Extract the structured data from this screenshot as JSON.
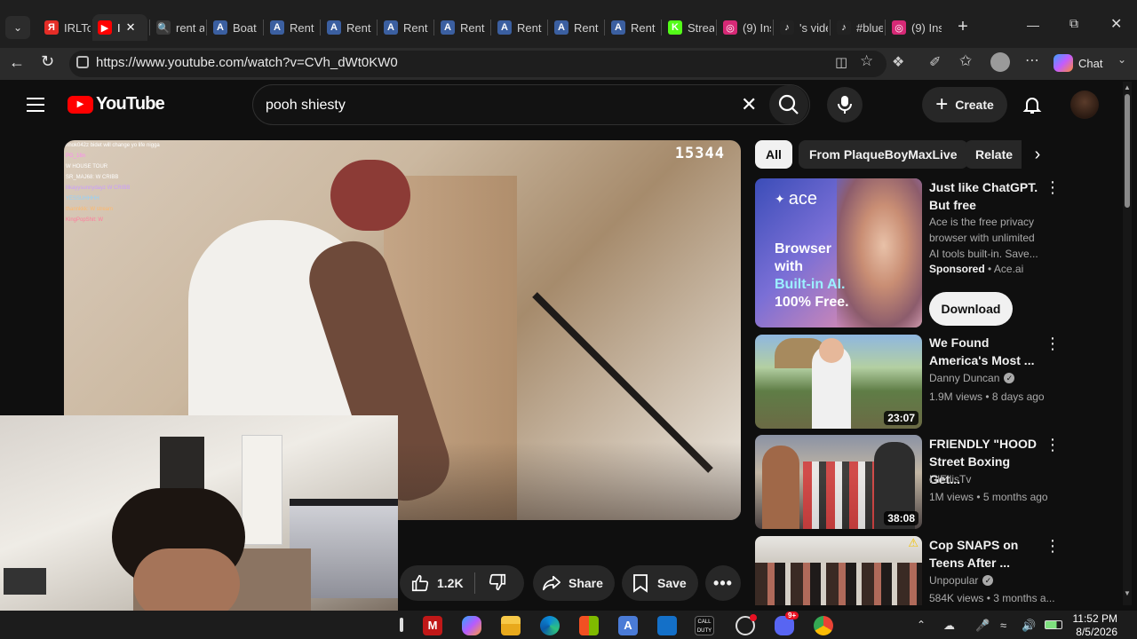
{
  "browser": {
    "tabs": [
      {
        "label": "IRLToo",
        "icon": "Я",
        "color": "#e52d27"
      },
      {
        "label": "I",
        "icon": "▶",
        "color": "#ff0000",
        "active": true
      },
      {
        "label": "rent a",
        "icon": "🔍",
        "color": "#3a3a3a"
      },
      {
        "label": "Boat",
        "icon": "A",
        "color": "#3b5fa0"
      },
      {
        "label": "Rent",
        "icon": "A",
        "color": "#3b5fa0"
      },
      {
        "label": "Rent",
        "icon": "A",
        "color": "#3b5fa0"
      },
      {
        "label": "Rent",
        "icon": "A",
        "color": "#3b5fa0"
      },
      {
        "label": "Rent",
        "icon": "A",
        "color": "#3b5fa0"
      },
      {
        "label": "Rent",
        "icon": "A",
        "color": "#3b5fa0"
      },
      {
        "label": "Rent",
        "icon": "A",
        "color": "#3b5fa0"
      },
      {
        "label": "Rent",
        "icon": "A",
        "color": "#3b5fa0"
      },
      {
        "label": "Strear",
        "icon": "K",
        "color": "#53fc18"
      },
      {
        "label": "(9) Ins",
        "icon": "◎",
        "color": "#d62976"
      },
      {
        "label": "'s vide",
        "icon": "♪",
        "color": "#222"
      },
      {
        "label": "#blue",
        "icon": "♪",
        "color": "#222"
      },
      {
        "label": "(9) Ins",
        "icon": "◎",
        "color": "#d62976"
      }
    ],
    "url": "https://www.youtube.com/watch?v=CVh_dWt0KW0",
    "chat_label": "Chat"
  },
  "youtube": {
    "logo_text": "YouTube",
    "search_value": "pooh shiesty",
    "create_label": "Create",
    "video_counter": "15344",
    "chat_messages": [
      "nnok042z bidet will change yo life nigga",
      "PG_16n",
      "W HOUSE TOUR",
      "SR_MAJ68: W CRIBB",
      "llikayysunnydayz W CRIBB",
      "YESSUHHHH",
      "thannkkk: W stream",
      "KingPopShit: W"
    ],
    "chips": [
      {
        "label": "All",
        "selected": true
      },
      {
        "label": "From PlaqueBoyMaxLive",
        "selected": false
      },
      {
        "label": "Relate",
        "selected": false
      }
    ],
    "ad": {
      "thumb_brand": "ace",
      "thumb_text": "Browser with Built-in AI. 100% Free.",
      "thumb_line1": "Browser",
      "thumb_line2": "with",
      "thumb_line3": "Built-in AI.",
      "thumb_line4": "100% Free.",
      "title": "Just like ChatGPT. But free",
      "description": "Ace is the free privacy browser with unlimited AI tools built-in. Save...",
      "sponsored": "Sponsored",
      "advertiser": "Ace.ai",
      "cta": "Download"
    },
    "recommendations": [
      {
        "title": "We Found America's Most ...",
        "channel": "Danny Duncan",
        "verified": true,
        "meta": "1.9M views • 8 days ago",
        "duration": "23:07"
      },
      {
        "title": "FRIENDLY \"HOOD Street Boxing Get...",
        "channel": "LilEllisTv",
        "verified": false,
        "meta": "1M views • 5 months ago",
        "duration": "38:08"
      },
      {
        "title": "Cop SNAPS on Teens After ...",
        "channel": "Unpopular",
        "verified": true,
        "meta": "584K views • 3 months a...",
        "duration": ""
      }
    ],
    "actions": {
      "likes": "1.2K",
      "share": "Share",
      "save": "Save"
    }
  },
  "taskbar": {
    "time": "11:52 PM",
    "date": "8/5/2026",
    "badge": "9+"
  }
}
